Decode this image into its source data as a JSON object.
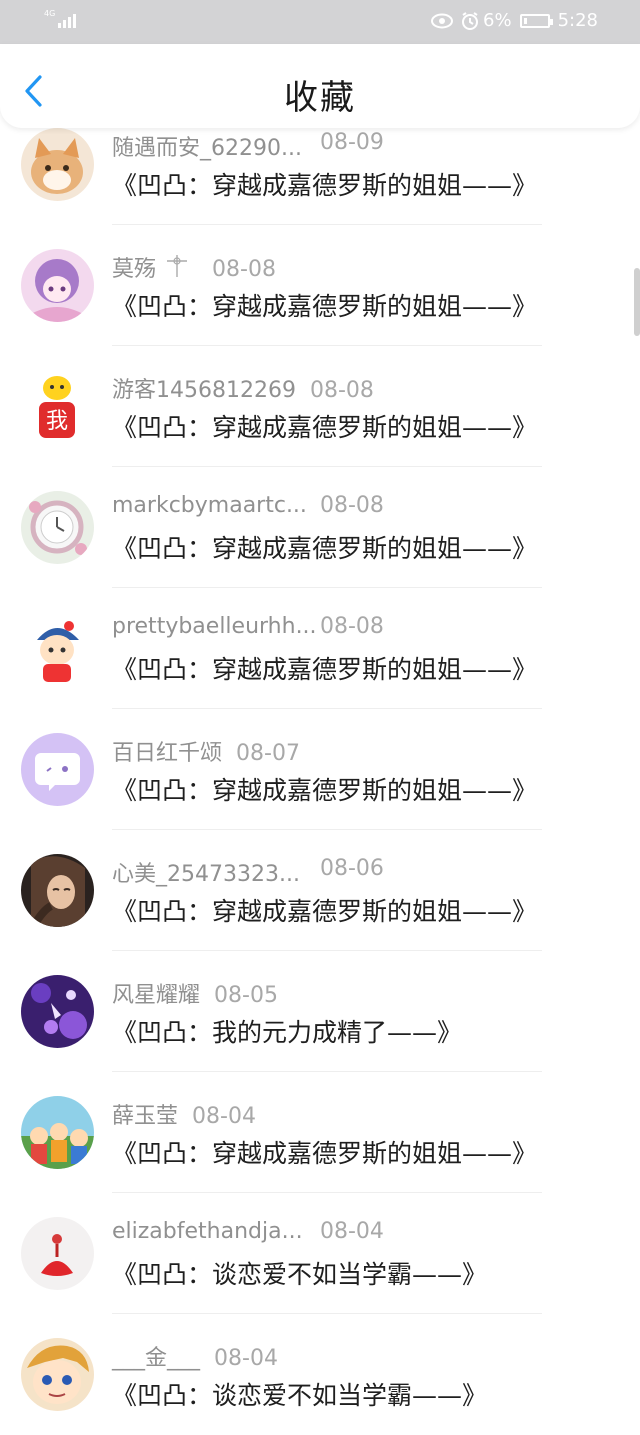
{
  "status_bar": {
    "network": "4G",
    "battery": "6%",
    "time": "5:28"
  },
  "header": {
    "title": "收藏"
  },
  "items": [
    {
      "name": "随遇而安_62290...",
      "date": "08-09",
      "content": "《凹凸：穿越成嘉德罗斯的姐姐——》"
    },
    {
      "name": "莫殇",
      "date": "08-08",
      "content": "《凹凸：穿越成嘉德罗斯的姐姐——》"
    },
    {
      "name": "游客1456812269",
      "date": "08-08",
      "content": "《凹凸：穿越成嘉德罗斯的姐姐——》"
    },
    {
      "name": "markcbymaartc...",
      "date": "08-08",
      "content": "《凹凸：穿越成嘉德罗斯的姐姐——》"
    },
    {
      "name": "prettybaelleurhh...",
      "date": "08-08",
      "content": "《凹凸：穿越成嘉德罗斯的姐姐——》"
    },
    {
      "name": "百日红千颂",
      "date": "08-07",
      "content": "《凹凸：穿越成嘉德罗斯的姐姐——》"
    },
    {
      "name": "心美_25473323...",
      "date": "08-06",
      "content": "《凹凸：穿越成嘉德罗斯的姐姐——》"
    },
    {
      "name": "风星耀耀",
      "date": "08-05",
      "content": "《凹凸：我的元力成精了——》"
    },
    {
      "name": "薛玉莹",
      "date": "08-04",
      "content": "《凹凸：穿越成嘉德罗斯的姐姐——》"
    },
    {
      "name": "elizabfethandja...",
      "date": "08-04",
      "content": "《凹凸：谈恋爱不如当学霸——》"
    },
    {
      "name": "___金___",
      "date": "08-04",
      "content": "《凹凸：谈恋爱不如当学霸——》"
    }
  ],
  "colors": {
    "accent": "#2196f3",
    "status_bar_bg": "#d3d3d5",
    "meta_text": "#909090",
    "content_text": "#1f1f1f"
  },
  "icons": {
    "back": "chevron-left-icon",
    "eye": "eye-icon",
    "alarm": "alarm-clock-icon",
    "battery": "battery-icon",
    "signal": "signal-icon"
  }
}
